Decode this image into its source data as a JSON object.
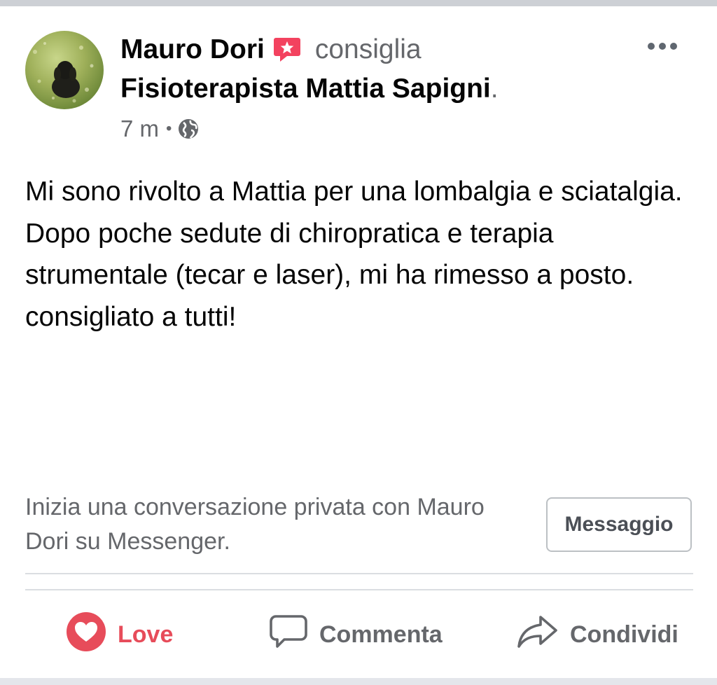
{
  "post": {
    "author": "Mauro Dori",
    "action_verb": "consiglia",
    "page_name": "Fisioterapista Mattia Sapigni",
    "page_suffix": ".",
    "timestamp": "7 m",
    "separator": "•",
    "privacy_icon": "globe-icon",
    "recommend_icon": "recommendation-star-icon",
    "more_icon": "more-options-icon",
    "body_lines": [
      "Mi sono rivolto a Mattia per una lombalgia e sciatalgia.",
      "Dopo poche sedute di chiropratica e terapia strumentale (tecar e laser), mi ha rimesso a posto.",
      "consigliato a tutti!"
    ]
  },
  "messenger": {
    "prompt": "Inizia una conversazione privata con Mauro Dori su Messenger.",
    "button_label": "Messaggio"
  },
  "actions": {
    "love": {
      "label": "Love",
      "icon": "love-reaction-icon",
      "color": "#e74c5a"
    },
    "comment": {
      "label": "Commenta",
      "icon": "comment-icon"
    },
    "share": {
      "label": "Condividi",
      "icon": "share-icon"
    }
  },
  "colors": {
    "recommend_badge": "#f3425f",
    "secondary_text": "#65676b",
    "primary_text": "#050505"
  }
}
